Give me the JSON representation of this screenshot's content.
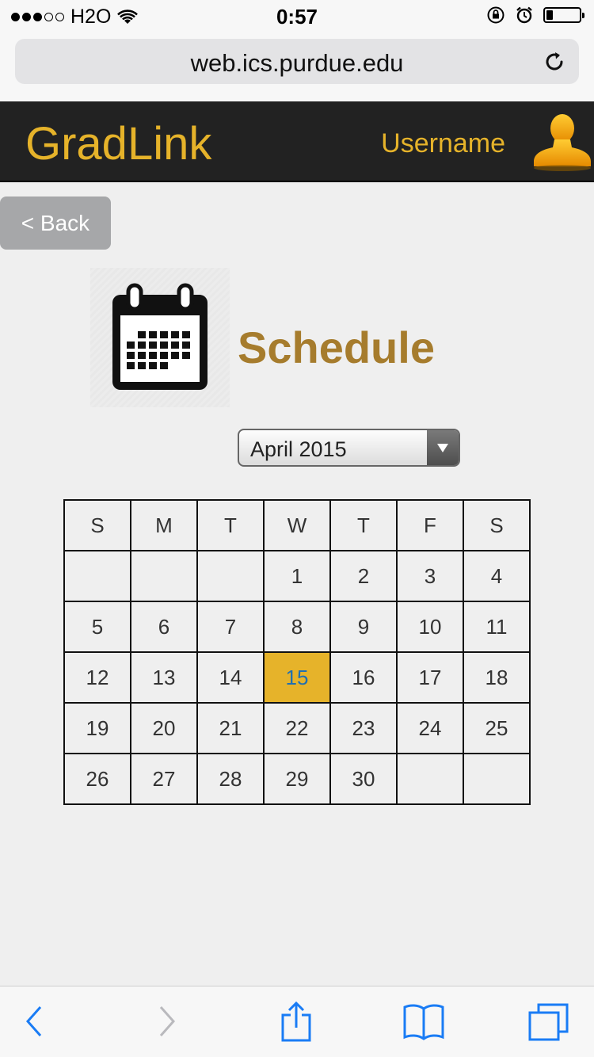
{
  "status_bar": {
    "carrier": "H2O",
    "time": "0:57",
    "signal_bars_filled": 3,
    "signal_bars_total": 5,
    "battery_level": 0.2
  },
  "browser": {
    "url": "web.ics.purdue.edu"
  },
  "app": {
    "brand": "GradLink",
    "username": "Username",
    "brand_color": "#e6b32a"
  },
  "back_label": "< Back",
  "page": {
    "title": "Schedule",
    "title_color": "#a67c2d"
  },
  "month_select": {
    "value": "April 2015"
  },
  "calendar": {
    "weekdays": [
      "S",
      "M",
      "T",
      "W",
      "T",
      "F",
      "S"
    ],
    "weeks": [
      [
        "",
        "",
        "",
        "1",
        "2",
        "3",
        "4"
      ],
      [
        "5",
        "6",
        "7",
        "8",
        "9",
        "10",
        "11"
      ],
      [
        "12",
        "13",
        "14",
        "15",
        "16",
        "17",
        "18"
      ],
      [
        "19",
        "20",
        "21",
        "22",
        "23",
        "24",
        "25"
      ],
      [
        "26",
        "27",
        "28",
        "29",
        "30",
        "",
        ""
      ]
    ],
    "selected_day": "15",
    "selected_color": "#e6b32a"
  },
  "toolbar": {
    "icons": [
      "back-icon",
      "forward-icon",
      "share-icon",
      "bookmarks-icon",
      "tabs-icon"
    ]
  }
}
